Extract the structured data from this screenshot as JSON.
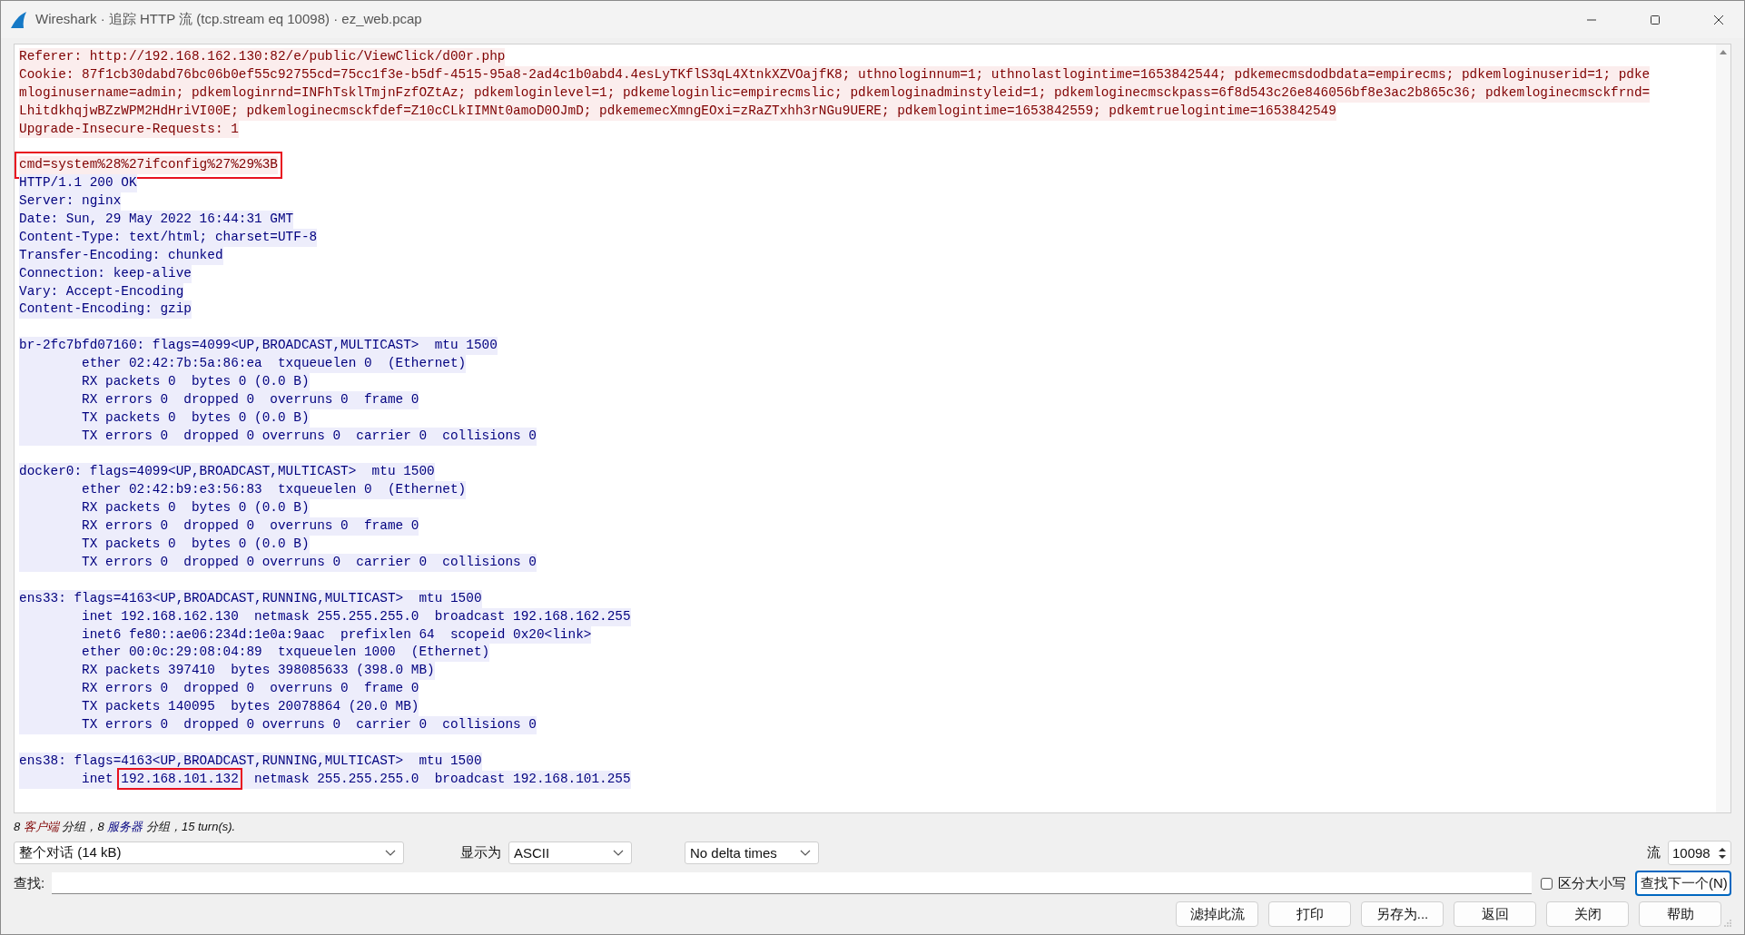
{
  "window": {
    "title": "Wireshark · 追踪 HTTP 流 (tcp.stream eq 10098) · ez_web.pcap"
  },
  "stream": [
    {
      "kind": "client",
      "text": "Referer: http://192.168.162.130:82/e/public/ViewClick/d00r.php"
    },
    {
      "kind": "client",
      "text": "Cookie: 87f1cb30dabd76bc06b0ef55c92755cd=75cc1f3e-b5df-4515-95a8-2ad4c1b0abd4.4esLyTKflS3qL4XtnkXZVOajfK8; uthnologinnum=1; uthnolastlogintime=1653842544; pdkemecmsdodbdata=empirecms; pdkemloginuserid=1; pdke"
    },
    {
      "kind": "client",
      "text": "mloginusername=admin; pdkemloginrnd=INFhTsklTmjnFzfOZtAz; pdkemloginlevel=1; pdkemeloginlic=empirecmslic; pdkemloginadminstyleid=1; pdkemloginecmsckpass=6f8d543c26e846056bf8e3ac2b865c36; pdkemloginecmsckfrnd="
    },
    {
      "kind": "client",
      "text": "LhitdkhqjwBZzWPM2HdHriVI00E; pdkemloginecmsckfdef=Z10cCLkIIMNt0amoD0OJmD; pdkememecXmngEOxi=zRaZTxhh3rNGu9UERE; pdkemlogintime=1653842559; pdkemtruelogintime=1653842549"
    },
    {
      "kind": "client",
      "text": "Upgrade-Insecure-Requests: 1"
    },
    {
      "kind": "gap"
    },
    {
      "kind": "client",
      "text": "cmd=system%28%27ifconfig%27%29%3B",
      "boxed": true
    },
    {
      "kind": "server",
      "text": "HTTP/1.1 200 OK"
    },
    {
      "kind": "server",
      "text": "Server: nginx"
    },
    {
      "kind": "server",
      "text": "Date: Sun, 29 May 2022 16:44:31 GMT"
    },
    {
      "kind": "server",
      "text": "Content-Type: text/html; charset=UTF-8"
    },
    {
      "kind": "server",
      "text": "Transfer-Encoding: chunked"
    },
    {
      "kind": "server",
      "text": "Connection: keep-alive"
    },
    {
      "kind": "server",
      "text": "Vary: Accept-Encoding"
    },
    {
      "kind": "server",
      "text": "Content-Encoding: gzip"
    },
    {
      "kind": "gap"
    },
    {
      "kind": "server",
      "text": "br-2fc7bfd07160: flags=4099<UP,BROADCAST,MULTICAST>  mtu 1500"
    },
    {
      "kind": "server",
      "text": "        ether 02:42:7b:5a:86:ea  txqueuelen 0  (Ethernet)"
    },
    {
      "kind": "server",
      "text": "        RX packets 0  bytes 0 (0.0 B)"
    },
    {
      "kind": "server",
      "text": "        RX errors 0  dropped 0  overruns 0  frame 0"
    },
    {
      "kind": "server",
      "text": "        TX packets 0  bytes 0 (0.0 B)"
    },
    {
      "kind": "server",
      "text": "        TX errors 0  dropped 0 overruns 0  carrier 0  collisions 0"
    },
    {
      "kind": "gap"
    },
    {
      "kind": "server",
      "text": "docker0: flags=4099<UP,BROADCAST,MULTICAST>  mtu 1500"
    },
    {
      "kind": "server",
      "text": "        ether 02:42:b9:e3:56:83  txqueuelen 0  (Ethernet)"
    },
    {
      "kind": "server",
      "text": "        RX packets 0  bytes 0 (0.0 B)"
    },
    {
      "kind": "server",
      "text": "        RX errors 0  dropped 0  overruns 0  frame 0"
    },
    {
      "kind": "server",
      "text": "        TX packets 0  bytes 0 (0.0 B)"
    },
    {
      "kind": "server",
      "text": "        TX errors 0  dropped 0 overruns 0  carrier 0  collisions 0"
    },
    {
      "kind": "gap"
    },
    {
      "kind": "server",
      "text": "ens33: flags=4163<UP,BROADCAST,RUNNING,MULTICAST>  mtu 1500"
    },
    {
      "kind": "server",
      "text": "        inet 192.168.162.130  netmask 255.255.255.0  broadcast 192.168.162.255"
    },
    {
      "kind": "server",
      "text": "        inet6 fe80::ae06:234d:1e0a:9aac  prefixlen 64  scopeid 0x20<link>"
    },
    {
      "kind": "server",
      "text": "        ether 00:0c:29:08:04:89  txqueuelen 1000  (Ethernet)"
    },
    {
      "kind": "server",
      "text": "        RX packets 397410  bytes 398085633 (398.0 MB)"
    },
    {
      "kind": "server",
      "text": "        RX errors 0  dropped 0  overruns 0  frame 0"
    },
    {
      "kind": "server",
      "text": "        TX packets 140095  bytes 20078864 (20.0 MB)"
    },
    {
      "kind": "server",
      "text": "        TX errors 0  dropped 0 overruns 0  carrier 0  collisions 0"
    },
    {
      "kind": "gap"
    },
    {
      "kind": "server",
      "text": "ens38: flags=4163<UP,BROADCAST,RUNNING,MULTICAST>  mtu 1500"
    },
    {
      "kind": "server",
      "parts": [
        {
          "text": "        inet "
        },
        {
          "text": "192.168.101.132",
          "boxed": true
        },
        {
          "text": "  netmask 255.255.255.0  broadcast 192.168.101.255"
        }
      ]
    }
  ],
  "summary": [
    {
      "text": "8 "
    },
    {
      "text": "客户端",
      "kind": "client"
    },
    {
      "text": " 分组，8 "
    },
    {
      "text": "服务器",
      "kind": "server"
    },
    {
      "text": " 分组，15 turn(s)."
    }
  ],
  "conversation_select": {
    "value": "整个对话 (14 kB)"
  },
  "show_as": {
    "label": "显示为",
    "value": "ASCII"
  },
  "delta_select": {
    "value": "No delta times"
  },
  "stream_number": {
    "label": "流",
    "value": "10098"
  },
  "find": {
    "label": "查找:"
  },
  "case_sensitive": {
    "label": "区分大小写",
    "checked": false
  },
  "find_next": {
    "label": "查找下一个(N)"
  },
  "buttons": [
    "滤掉此流",
    "打印",
    "另存为...",
    "返回",
    "关闭",
    "帮助"
  ]
}
